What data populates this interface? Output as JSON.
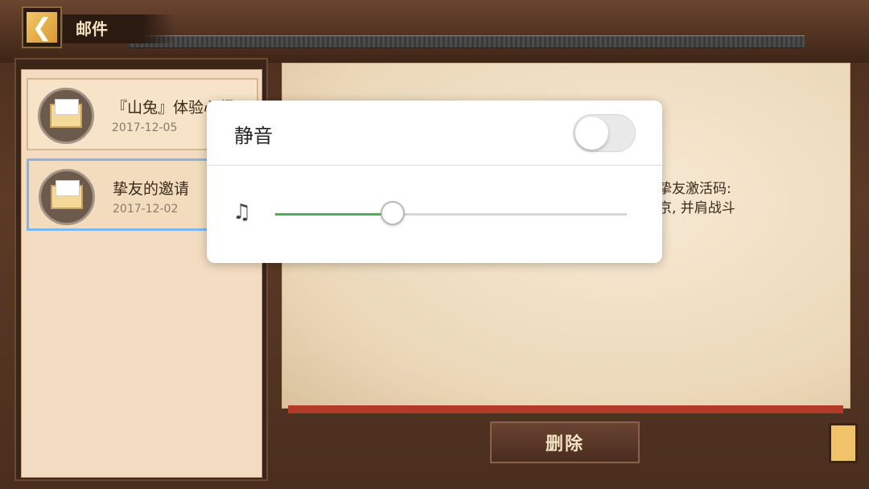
{
  "header": {
    "title": "邮件",
    "back_icon": "chevron-left-icon"
  },
  "mails": [
    {
      "title": "『山兔』体验心得",
      "date": "2017-12-05",
      "icon": "envelope-icon"
    },
    {
      "title": "挚友的邀请",
      "date": "2017-12-02",
      "icon": "envelope-icon"
    }
  ],
  "content": {
    "line1": "挚友激活码:",
    "line2": "京, 并肩战斗"
  },
  "delete_label": "删除",
  "popup": {
    "mute_label": "静音",
    "mute_on": false,
    "volume_icon": "music-note-icon",
    "volume_level": 0.334,
    "accent_color": "#4cb05a"
  }
}
